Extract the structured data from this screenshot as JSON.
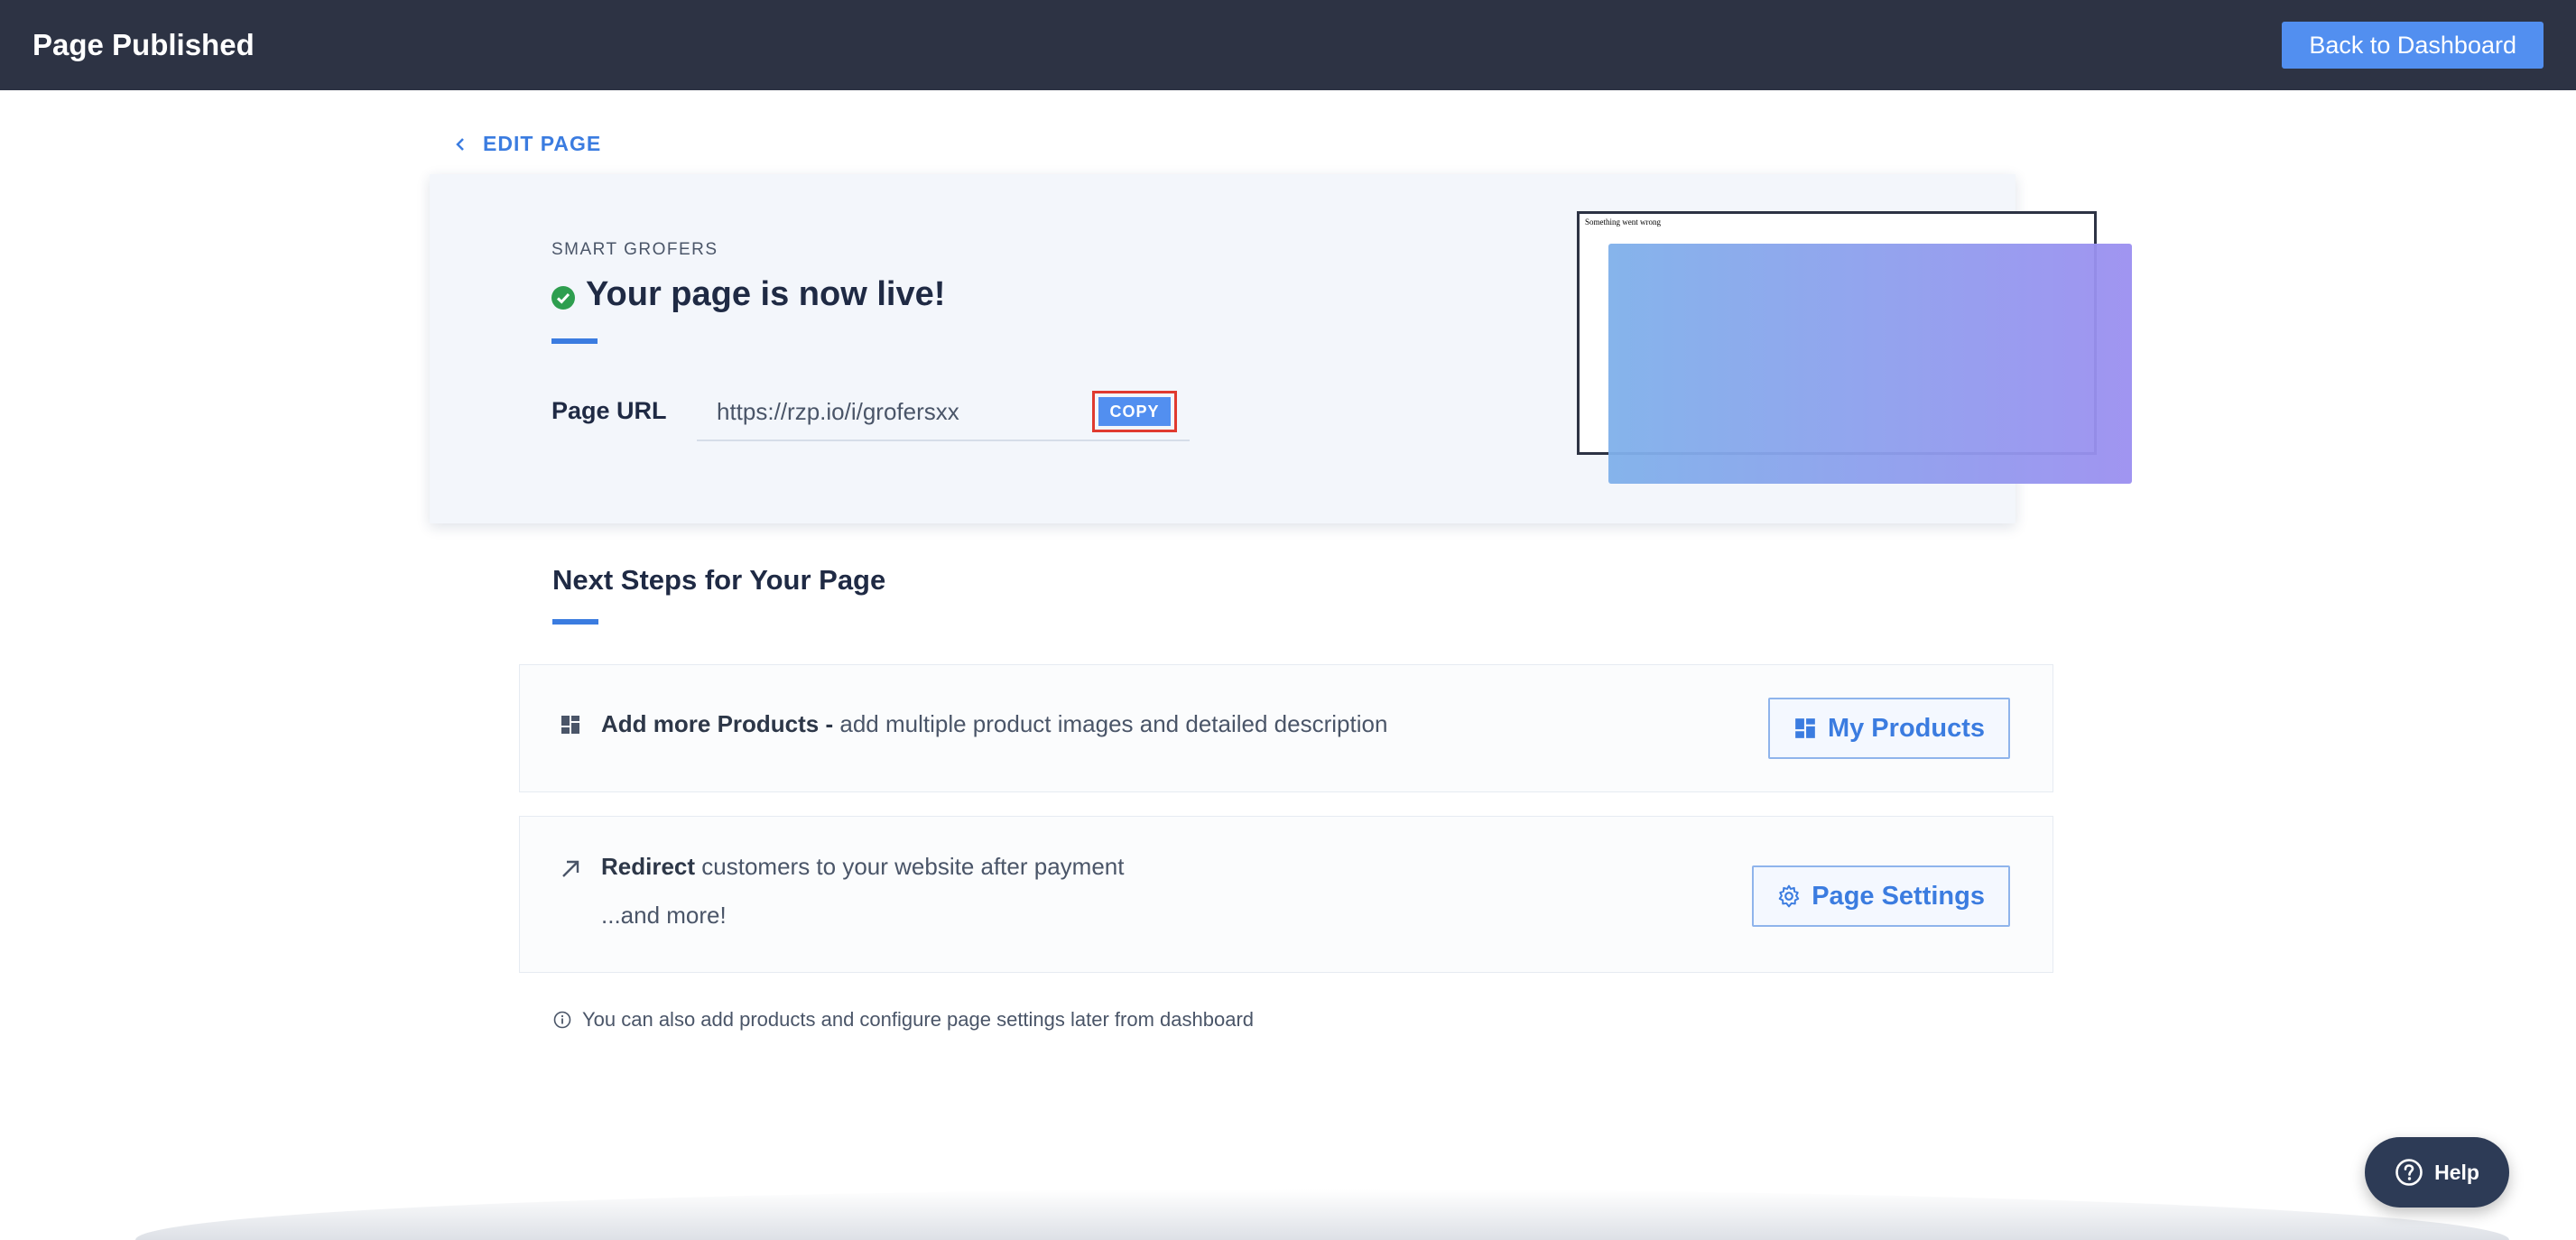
{
  "header": {
    "title": "Page Published",
    "back_label": "Back to Dashboard"
  },
  "edit_link": {
    "label": "EDIT PAGE"
  },
  "live": {
    "merchant": "SMART GROFERS",
    "headline": "Your page is now live!",
    "url_label": "Page URL",
    "url_value": "https://rzp.io/i/grofersxx",
    "copy_label": "COPY"
  },
  "preview": {
    "error_text": "Something went wrong"
  },
  "next_steps": {
    "title": "Next Steps for Your Page",
    "products": {
      "bold": "Add more Products -",
      "text": " add multiple product images and detailed description",
      "button": "My Products"
    },
    "redirect": {
      "bold": "Redirect",
      "text": " customers to your website after payment",
      "more": "...and more!",
      "button": "Page Settings"
    },
    "note": "You can also add products and configure page settings later from dashboard"
  },
  "help": {
    "label": "Help"
  },
  "colors": {
    "topbar": "#2d3344",
    "primary": "#528ff0",
    "accent": "#3b7ce0",
    "success": "#2e9e4f",
    "highlight": "#e03a2f"
  }
}
